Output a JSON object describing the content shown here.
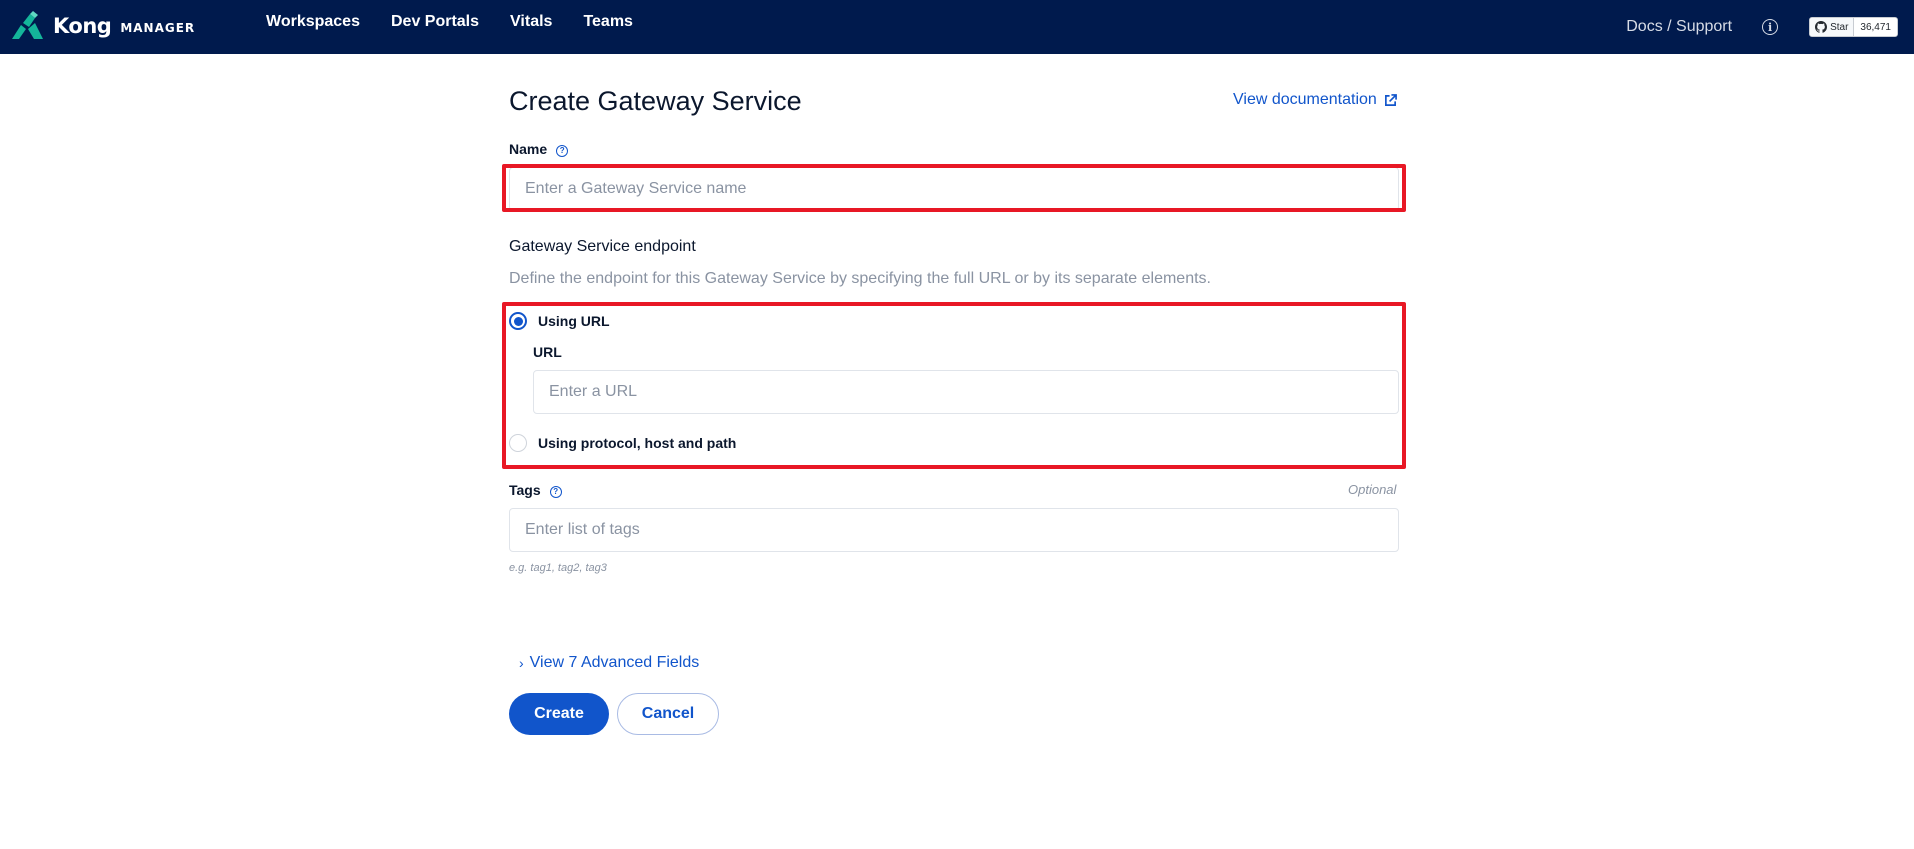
{
  "brand": {
    "name": "Kong",
    "suffix": "MANAGER",
    "icon": "kong-logo-icon"
  },
  "nav": {
    "items": [
      {
        "label": "Workspaces"
      },
      {
        "label": "Dev Portals"
      },
      {
        "label": "Vitals"
      },
      {
        "label": "Teams"
      }
    ],
    "docs_support": "Docs / Support",
    "info_icon": "info-icon",
    "github": {
      "star_label": "Star",
      "count": "36,471",
      "icon": "github-icon"
    }
  },
  "form": {
    "title": "Create Gateway Service",
    "view_documentation": "View documentation",
    "name": {
      "label": "Name",
      "placeholder": "Enter a Gateway Service name",
      "value": ""
    },
    "endpoint": {
      "title": "Gateway Service endpoint",
      "description": "Define the endpoint for this Gateway Service by specifying the full URL or by its separate elements.",
      "option_url": "Using URL",
      "url_label": "URL",
      "url_placeholder": "Enter a URL",
      "option_protocol": "Using protocol, host and path",
      "selected": "Using URL"
    },
    "tags": {
      "label": "Tags",
      "optional": "Optional",
      "placeholder": "Enter list of tags",
      "hint": "e.g. tag1, tag2, tag3"
    },
    "advanced": {
      "chevron": "›",
      "label": "View 7 Advanced Fields"
    },
    "create_label": "Create",
    "cancel_label": "Cancel"
  },
  "colors": {
    "nav_bg": "#001a4d",
    "accent": "#1155cb",
    "highlight": "#e81825",
    "logo_teal": "#14b59a"
  }
}
